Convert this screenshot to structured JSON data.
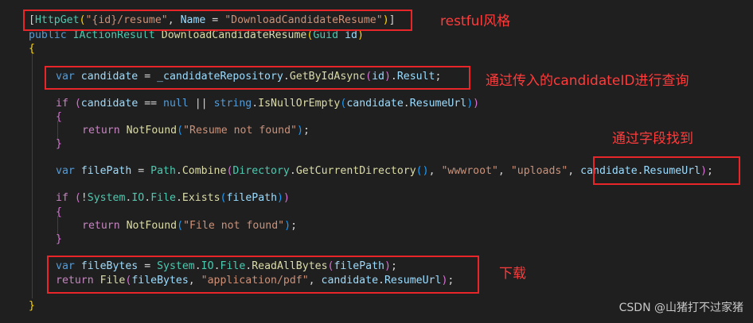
{
  "code": {
    "attr_open": "[",
    "attr_httpget": "HttpGet",
    "attr_paren_open": "(",
    "attr_route": "\"{id}/resume\"",
    "attr_comma": ", ",
    "attr_name": "Name",
    "attr_eq": " = ",
    "attr_name_value": "\"DownloadCandidateResume\"",
    "attr_paren_close": ")",
    "attr_close": "]",
    "sig_public": "public",
    "sig_return_type": "IActionResult",
    "sig_method": "DownloadCandidateResume",
    "sig_paren_open": "(",
    "sig_param_type": "Guid",
    "sig_param_name": "id",
    "sig_paren_close": ")",
    "open_brace": "{",
    "l1_var": "var",
    "l1_name": "candidate",
    "l1_eq": " = ",
    "l1_repo": "_candidateRepository",
    "l1_dot": ".",
    "l1_method": "GetByIdAsync",
    "l1_po": "(",
    "l1_arg": "id",
    "l1_pc": ")",
    "l1_dot2": ".",
    "l1_result": "Result",
    "l1_semi": ";",
    "if1_kw": "if",
    "if1_po": "(",
    "if1_var": "candidate",
    "if1_eq": " == ",
    "if1_null": "null",
    "if1_or": " || ",
    "if1_string": "string",
    "if1_dot": ".",
    "if1_fn": "IsNullOrEmpty",
    "if1_po2": "(",
    "if1_var2": "candidate",
    "if1_dot2": ".",
    "if1_prop": "ResumeUrl",
    "if1_pc2": ")",
    "if1_pc": ")",
    "brace_open_1": "{",
    "ret1_kw": "return",
    "ret1_fn": "NotFound",
    "ret1_po": "(",
    "ret1_str": "\"Resume not found\"",
    "ret1_pc": ")",
    "ret1_semi": ";",
    "brace_close_1": "}",
    "fp_var": "var",
    "fp_name": "filePath",
    "fp_eq": " = ",
    "fp_path": "Path",
    "fp_dot": ".",
    "fp_combine": "Combine",
    "fp_po": "(",
    "fp_dir": "Directory",
    "fp_dot2": ".",
    "fp_getdir": "GetCurrentDirectory",
    "fp_paren": "()",
    "fp_comma1": ", ",
    "fp_str1": "\"wwwroot\"",
    "fp_comma2": ", ",
    "fp_str2": "\"uploads\"",
    "fp_comma3": ", ",
    "fp_cand": "candidate",
    "fp_dot3": ".",
    "fp_resume": "ResumeUrl",
    "fp_pc": ")",
    "fp_semi": ";",
    "if2_kw": "if",
    "if2_po": "(",
    "if2_not": "!",
    "if2_system": "System",
    "if2_dot": ".",
    "if2_io": "IO",
    "if2_dot2": ".",
    "if2_file": "File",
    "if2_dot3": ".",
    "if2_exists": "Exists",
    "if2_po2": "(",
    "if2_arg": "filePath",
    "if2_pc2": ")",
    "if2_pc": ")",
    "brace_open_2": "{",
    "ret2_kw": "return",
    "ret2_fn": "NotFound",
    "ret2_po": "(",
    "ret2_str": "\"File not found\"",
    "ret2_pc": ")",
    "ret2_semi": ";",
    "brace_close_2": "}",
    "fb_var": "var",
    "fb_name": "fileBytes",
    "fb_eq": " = ",
    "fb_system": "System",
    "fb_dot": ".",
    "fb_io": "IO",
    "fb_dot2": ".",
    "fb_file": "File",
    "fb_dot3": ".",
    "fb_read": "ReadAllBytes",
    "fb_po": "(",
    "fb_arg": "filePath",
    "fb_pc": ")",
    "fb_semi": ";",
    "rf_kw": "return",
    "rf_fn": "File",
    "rf_po": "(",
    "rf_arg1": "fileBytes",
    "rf_comma1": ", ",
    "rf_str": "\"application/pdf\"",
    "rf_comma2": ", ",
    "rf_cand": "candidate",
    "rf_dot": ".",
    "rf_resume": "ResumeUrl",
    "rf_pc": ")",
    "rf_semi": ";",
    "close_brace": "}"
  },
  "annotations": {
    "restful": "restful风格",
    "query_by_id": "通过传入的candidateID进行查询",
    "find_by_field": "通过字段找到",
    "download": "下载"
  },
  "watermark": "CSDN @山猪打不过家猪",
  "colors": {
    "background": "#1f1f1f",
    "keyword": "#569cd6",
    "control": "#c586c0",
    "type": "#4ec9b0",
    "function": "#dcdcaa",
    "string": "#ce9178",
    "variable": "#9cdcfe",
    "annotation_red": "#e8262a"
  }
}
